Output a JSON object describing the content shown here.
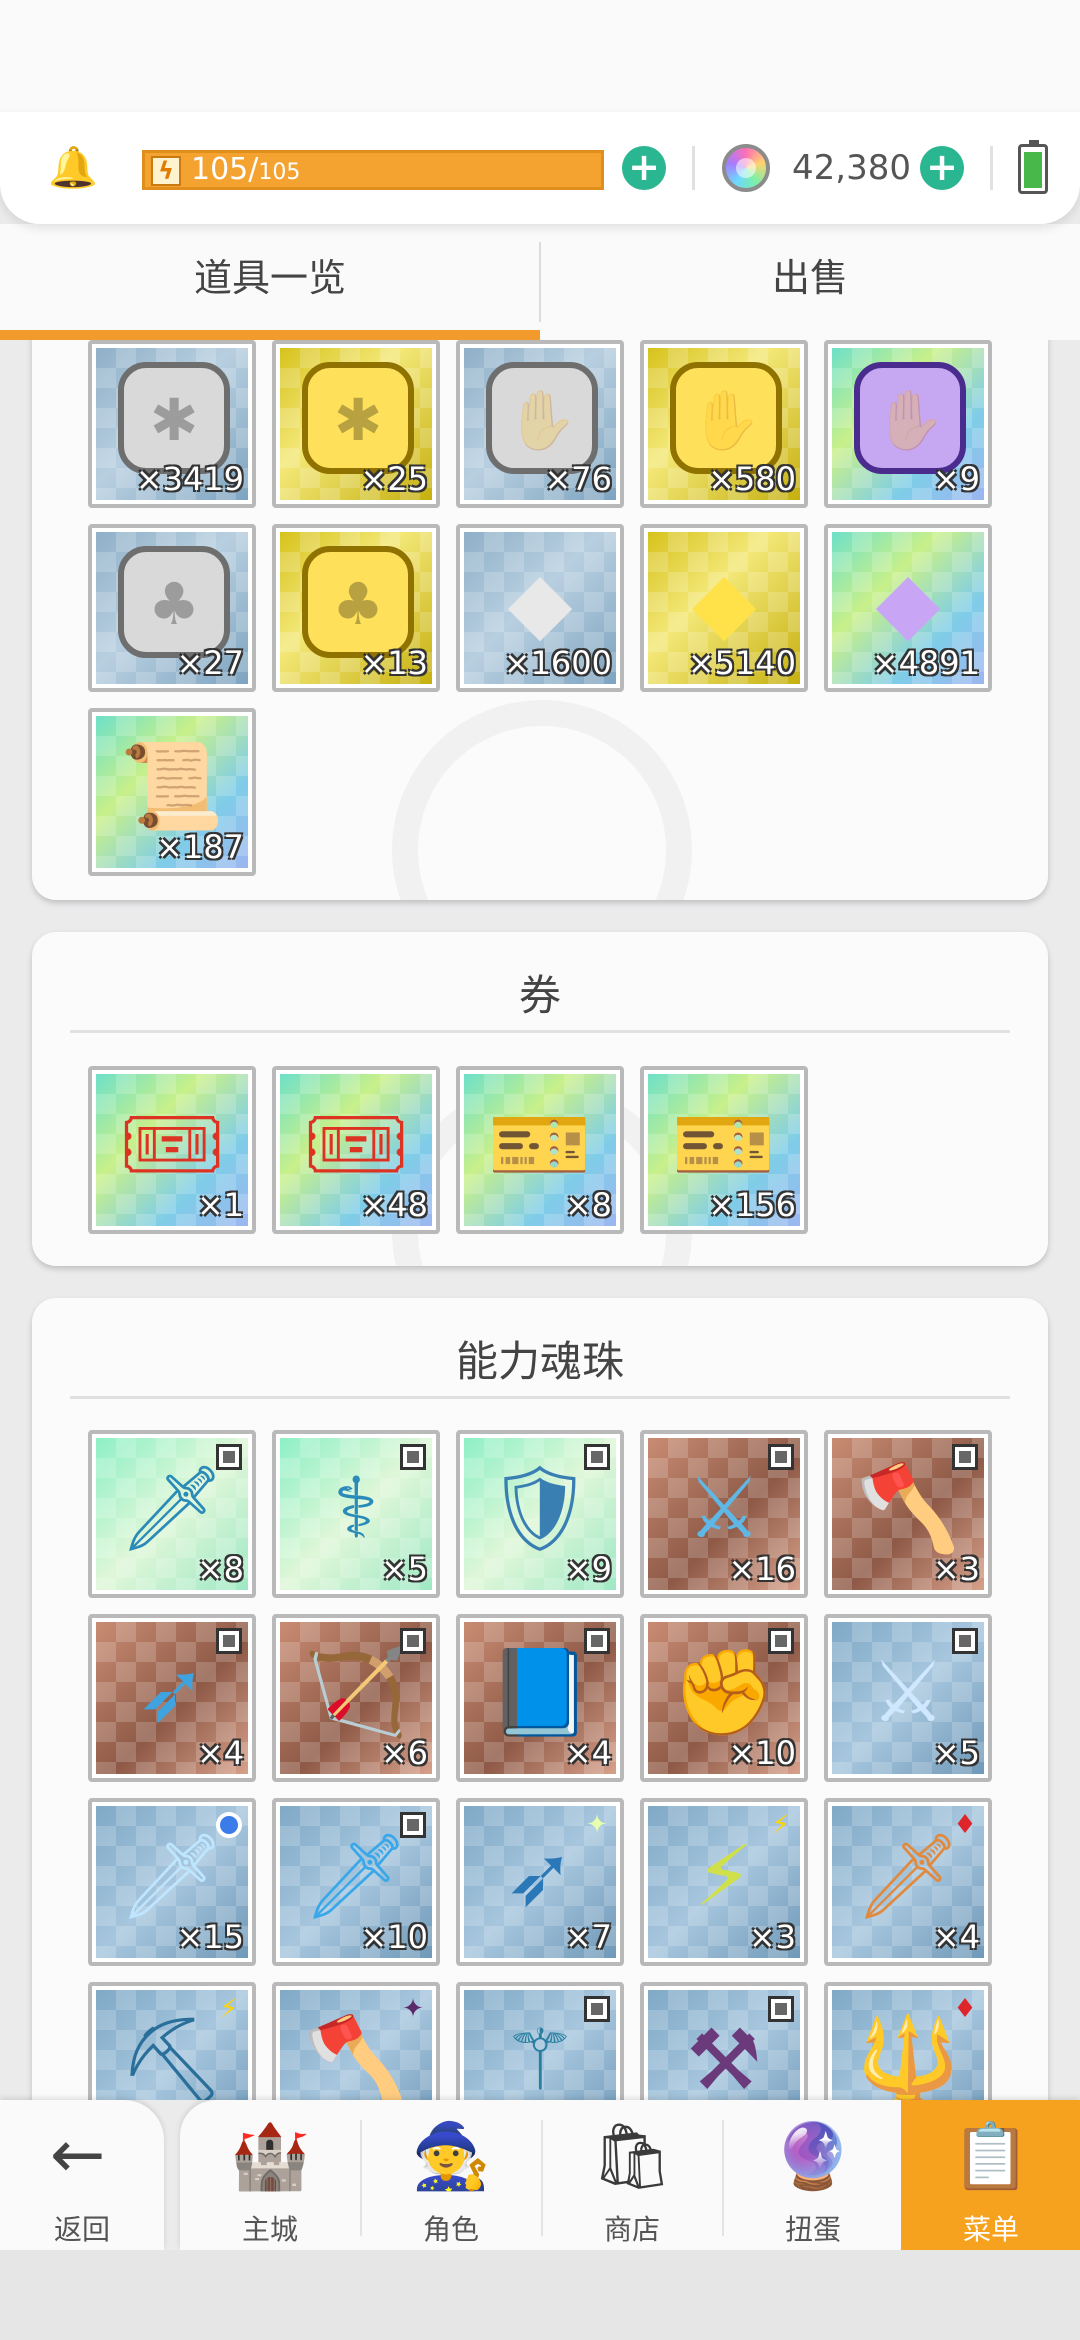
{
  "header": {
    "stamina_current": "105",
    "stamina_max": "105",
    "gem_count": "42,380"
  },
  "tabs": [
    {
      "label": "道具一览",
      "active": true
    },
    {
      "label": "出售",
      "active": false
    }
  ],
  "sections": {
    "materials": {
      "items": [
        {
          "icon": "silver-dragon-medal-icon",
          "count": "×3419"
        },
        {
          "icon": "gold-dragon-medal-icon",
          "count": "×25"
        },
        {
          "icon": "silver-beast-medal-icon",
          "count": "×76"
        },
        {
          "icon": "gold-beast-medal-icon",
          "count": "×580"
        },
        {
          "icon": "purple-beast-medal-icon",
          "count": "×9"
        },
        {
          "icon": "silver-tree-medal-icon",
          "count": "×27"
        },
        {
          "icon": "gold-tree-medal-icon",
          "count": "×13"
        },
        {
          "icon": "silver-shard-icon",
          "count": "×1600"
        },
        {
          "icon": "gold-shard-icon",
          "count": "×5140"
        },
        {
          "icon": "purple-shard-icon",
          "count": "×4891"
        },
        {
          "icon": "scroll-icon",
          "count": "×187"
        }
      ]
    },
    "tickets": {
      "title": "券",
      "items": [
        {
          "icon": "red-ticket-icon",
          "count": "×1"
        },
        {
          "icon": "red-ticket-icon",
          "count": "×48"
        },
        {
          "icon": "purple-ticket-stack-icon",
          "count": "×8"
        },
        {
          "icon": "purple-ticket-icon",
          "count": "×156"
        }
      ]
    },
    "soul_orbs": {
      "title": "能力魂珠",
      "items": [
        {
          "icon": "dagger-icon",
          "count": "×8",
          "badge": "square"
        },
        {
          "icon": "staff-icon",
          "count": "×5",
          "badge": "square"
        },
        {
          "icon": "shield-icon",
          "count": "×9",
          "badge": "square"
        },
        {
          "icon": "sword-icon",
          "count": "×16",
          "badge": "square"
        },
        {
          "icon": "axe-icon",
          "count": "×3",
          "badge": "square"
        },
        {
          "icon": "spear-icon",
          "count": "×4",
          "badge": "square"
        },
        {
          "icon": "bow-icon",
          "count": "×6",
          "badge": "square"
        },
        {
          "icon": "book-icon",
          "count": "×4",
          "badge": "square"
        },
        {
          "icon": "gauntlet-icon",
          "count": "×10",
          "badge": "square"
        },
        {
          "icon": "greatsword-icon",
          "count": "×5",
          "badge": "square"
        },
        {
          "icon": "broadsword-icon",
          "count": "×15",
          "badge": "circle"
        },
        {
          "icon": "blade-icon",
          "count": "×10",
          "badge": "square"
        },
        {
          "icon": "lance-icon",
          "count": "×7",
          "badge": "spark"
        },
        {
          "icon": "lightning-sword-icon",
          "count": "×3",
          "badge": "bolt"
        },
        {
          "icon": "flame-sword-icon",
          "count": "×4",
          "badge": "diamond"
        },
        {
          "icon": "crossbow-icon",
          "count": "",
          "badge": "bolt"
        },
        {
          "icon": "battle-axe-icon",
          "count": "",
          "badge": "star4"
        },
        {
          "icon": "scepter-icon",
          "count": "",
          "badge": "square"
        },
        {
          "icon": "halberd-icon",
          "count": "",
          "badge": "square"
        },
        {
          "icon": "trident-icon",
          "count": "",
          "badge": "diamond"
        }
      ]
    }
  },
  "nav": {
    "back": "返回",
    "items": [
      {
        "label": "主城",
        "icon": "castle-icon"
      },
      {
        "label": "角色",
        "icon": "character-icon"
      },
      {
        "label": "商店",
        "icon": "shop-icon"
      },
      {
        "label": "扭蛋",
        "icon": "gacha-icon"
      },
      {
        "label": "菜单",
        "icon": "menu-icon",
        "active": true
      }
    ]
  },
  "colors": {
    "accent": "#f39a2c",
    "stamina": "#f5a330",
    "plus": "#29b691"
  }
}
